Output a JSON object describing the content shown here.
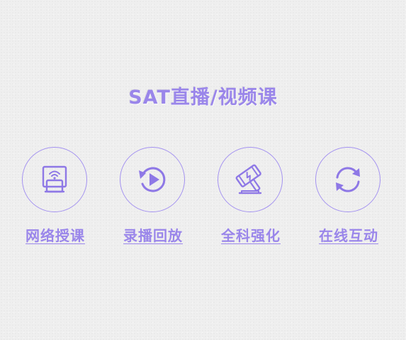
{
  "page": {
    "title": "SAT直播/视频课"
  },
  "features": [
    {
      "label": "网络授课",
      "icon": "online-teaching-icon"
    },
    {
      "label": "录播回放",
      "icon": "replay-icon"
    },
    {
      "label": "全科强化",
      "icon": "hammer-icon"
    },
    {
      "label": "在线互动",
      "icon": "interaction-icon"
    }
  ],
  "colors": {
    "accent": "#9a86ea",
    "background": "#efefef"
  }
}
